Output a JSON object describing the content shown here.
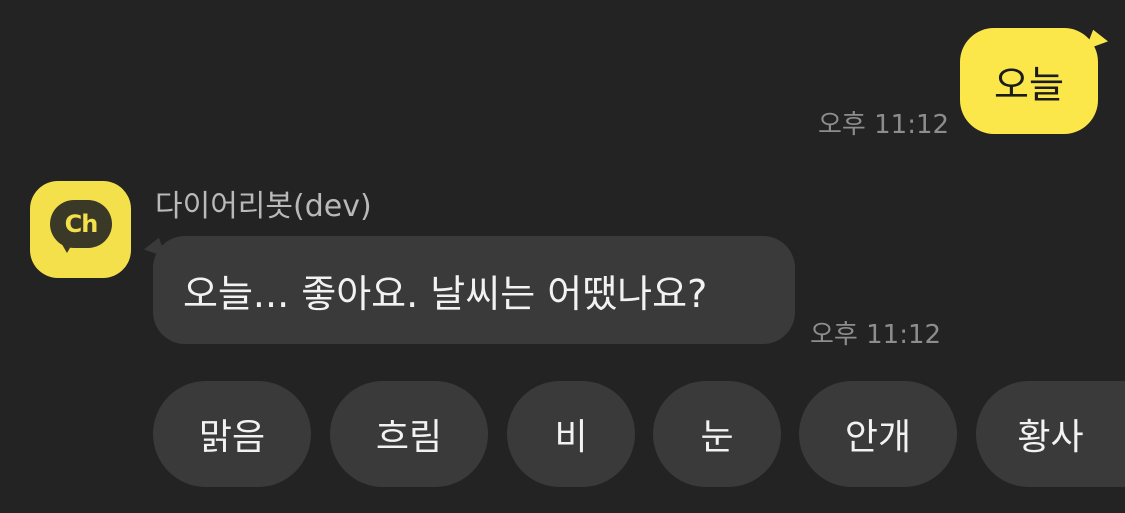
{
  "outgoing": {
    "text": "오늘",
    "time": "오후 11:12"
  },
  "bot": {
    "avatar_label": "Ch",
    "name": "다이어리봇(dev)",
    "message": "오늘... 좋아요. 날씨는 어땠나요?",
    "time": "오후 11:12"
  },
  "quick_replies": [
    "맑음",
    "흐림",
    "비",
    "눈",
    "안개",
    "황사"
  ],
  "colors": {
    "background": "#232323",
    "outgoing_bubble": "#fce74a",
    "incoming_bubble": "#3a3a3a",
    "avatar": "#f4e04a"
  }
}
